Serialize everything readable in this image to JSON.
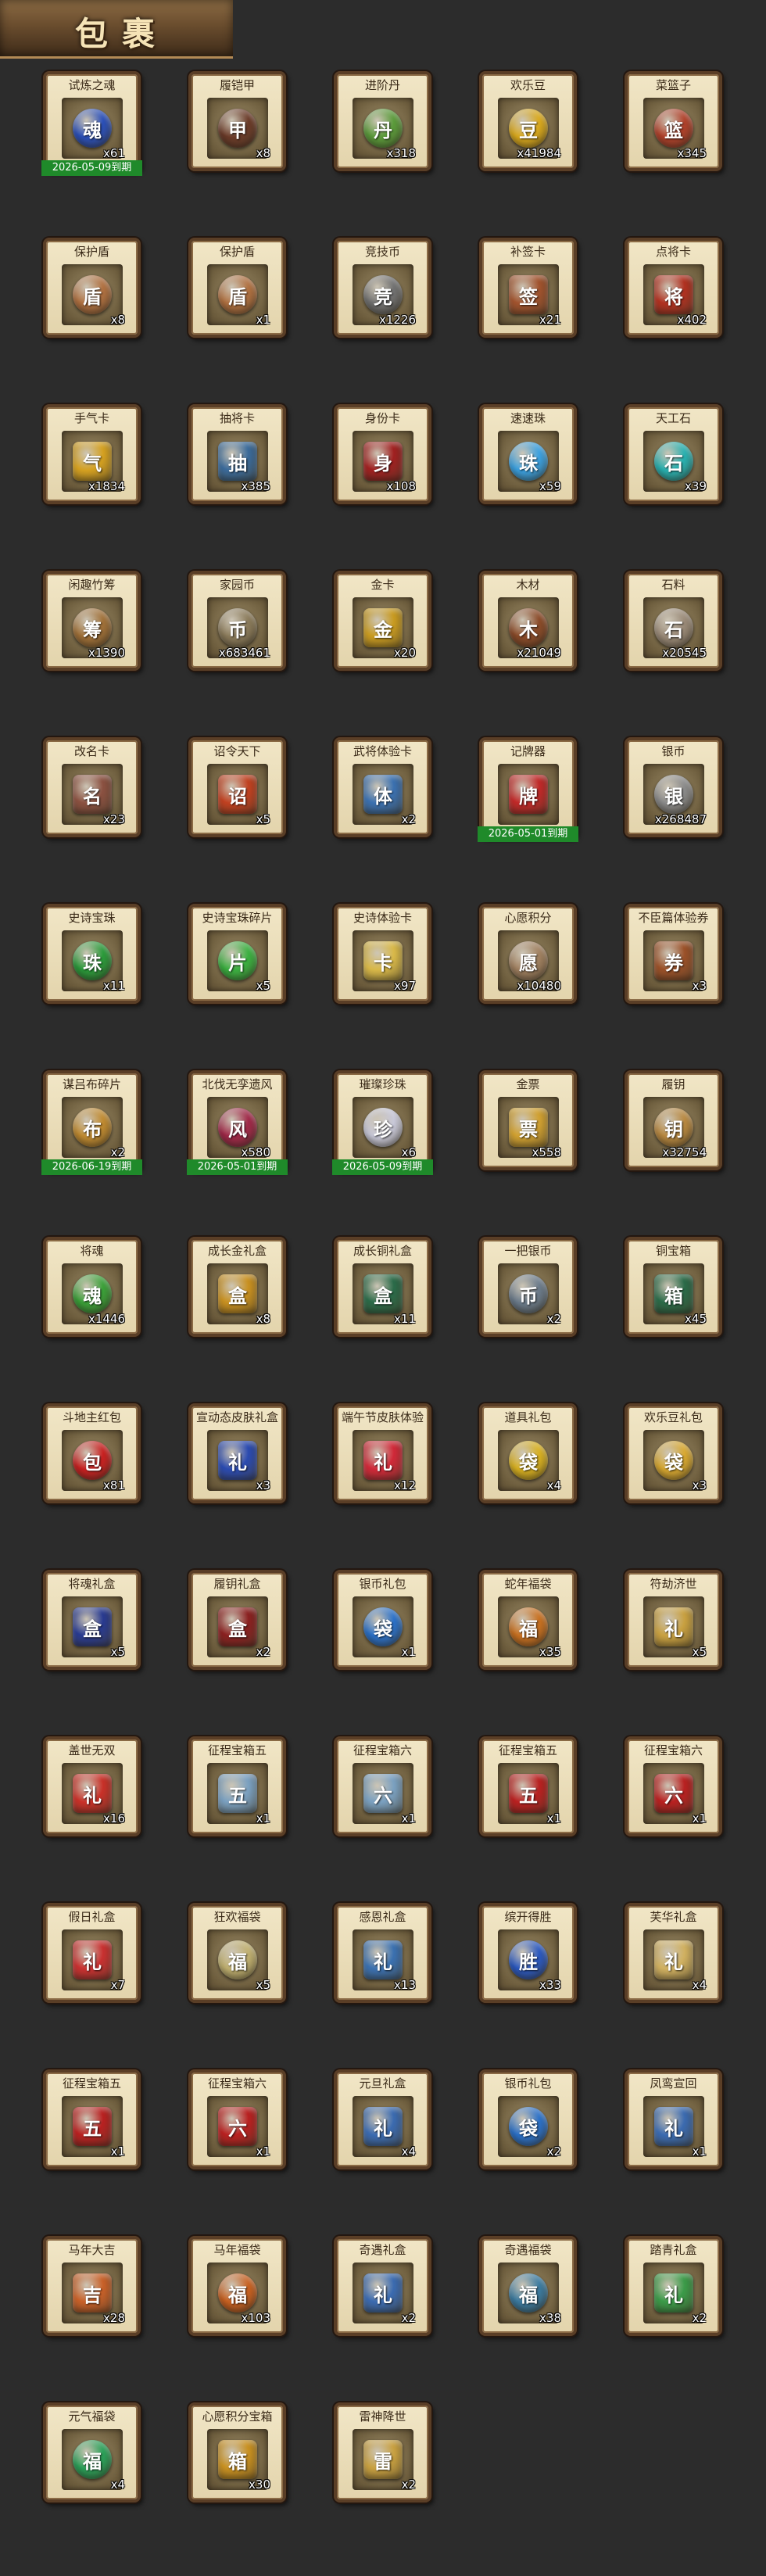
{
  "page": {
    "title": "包裹"
  },
  "items": [
    {
      "name": "试炼之魂",
      "qty": "x61",
      "expiry": "2026-05-09到期",
      "icon": "soul-orb-icon",
      "glyph": "魂",
      "color": "#2a4fb8"
    },
    {
      "name": "履铠甲",
      "qty": "x8",
      "expiry": "",
      "icon": "armor-icon",
      "glyph": "甲",
      "color": "#6a3a28"
    },
    {
      "name": "进阶丹",
      "qty": "x318",
      "expiry": "",
      "icon": "advance-pill-icon",
      "glyph": "丹",
      "color": "#5a9a3a"
    },
    {
      "name": "欢乐豆",
      "qty": "x41984",
      "expiry": "",
      "icon": "gold-beans-icon",
      "glyph": "豆",
      "color": "#d9a81c"
    },
    {
      "name": "菜篮子",
      "qty": "x345",
      "expiry": "",
      "icon": "basket-icon",
      "glyph": "篮",
      "color": "#b0402a"
    },
    {
      "name": "保护盾",
      "qty": "x8",
      "expiry": "",
      "icon": "shield-icon",
      "glyph": "盾",
      "color": "#b07040"
    },
    {
      "name": "保护盾",
      "qty": "x1",
      "expiry": "",
      "icon": "shield-icon",
      "glyph": "盾",
      "color": "#b07040"
    },
    {
      "name": "竞技币",
      "qty": "x1226",
      "expiry": "",
      "icon": "arena-coin-icon",
      "glyph": "竞",
      "color": "#707070"
    },
    {
      "name": "补签卡",
      "qty": "x21",
      "expiry": "",
      "icon": "resign-card-icon",
      "glyph": "签",
      "color": "#a0522d"
    },
    {
      "name": "点将卡",
      "qty": "x402",
      "expiry": "",
      "icon": "general-card-icon",
      "glyph": "将",
      "color": "#b03020"
    },
    {
      "name": "手气卡",
      "qty": "x1834",
      "expiry": "",
      "icon": "luck-card-icon",
      "glyph": "气",
      "color": "#d4a020"
    },
    {
      "name": "抽将卡",
      "qty": "x385",
      "expiry": "",
      "icon": "draw-card-icon",
      "glyph": "抽",
      "color": "#3a6a9a"
    },
    {
      "name": "身份卡",
      "qty": "x108",
      "expiry": "",
      "icon": "identity-card-icon",
      "glyph": "身",
      "color": "#a02020"
    },
    {
      "name": "速速珠",
      "qty": "x59",
      "expiry": "",
      "icon": "speed-pearl-icon",
      "glyph": "珠",
      "color": "#3aa0e0"
    },
    {
      "name": "天工石",
      "qty": "x39",
      "expiry": "",
      "icon": "gem-stone-icon",
      "glyph": "石",
      "color": "#28b0b0"
    },
    {
      "name": "闲趣竹筹",
      "qty": "x1390",
      "expiry": "",
      "icon": "bamboo-token-icon",
      "glyph": "筹",
      "color": "#a07038"
    },
    {
      "name": "家园币",
      "qty": "x683461",
      "expiry": "",
      "icon": "home-coin-icon",
      "glyph": "币",
      "color": "#8a7a5a"
    },
    {
      "name": "金卡",
      "qty": "x20",
      "expiry": "",
      "icon": "gold-card-icon",
      "glyph": "金",
      "color": "#c89a20"
    },
    {
      "name": "木材",
      "qty": "x21049",
      "expiry": "",
      "icon": "wood-icon",
      "glyph": "木",
      "color": "#8a4a28"
    },
    {
      "name": "石料",
      "qty": "x20545",
      "expiry": "",
      "icon": "stone-icon",
      "glyph": "石",
      "color": "#9a8a78"
    },
    {
      "name": "改名卡",
      "qty": "x23",
      "expiry": "",
      "icon": "rename-card-icon",
      "glyph": "名",
      "color": "#8a5040"
    },
    {
      "name": "诏令天下",
      "qty": "x5",
      "expiry": "",
      "icon": "decree-scroll-icon",
      "glyph": "诏",
      "color": "#c04020"
    },
    {
      "name": "武将体验卡",
      "qty": "x2",
      "expiry": "",
      "icon": "trial-card-icon",
      "glyph": "体",
      "color": "#3a70b0"
    },
    {
      "name": "记牌器",
      "qty": "",
      "expiry": "2026-05-01到期",
      "icon": "card-counter-icon",
      "glyph": "牌",
      "color": "#c02828"
    },
    {
      "name": "银币",
      "qty": "x268487",
      "expiry": "",
      "icon": "silver-coin-icon",
      "glyph": "银",
      "color": "#8a8a8a"
    },
    {
      "name": "史诗宝珠",
      "qty": "x11",
      "expiry": "",
      "icon": "epic-pearl-icon",
      "glyph": "珠",
      "color": "#2a9a3a"
    },
    {
      "name": "史诗宝珠碎片",
      "qty": "x5",
      "expiry": "",
      "icon": "pearl-fragment-icon",
      "glyph": "片",
      "color": "#3ab040"
    },
    {
      "name": "史诗体验卡",
      "qty": "x97",
      "expiry": "",
      "icon": "epic-trial-card-icon",
      "glyph": "卡",
      "color": "#d8b848"
    },
    {
      "name": "心愿积分",
      "qty": "x10480",
      "expiry": "",
      "icon": "wish-points-icon",
      "glyph": "愿",
      "color": "#a08060"
    },
    {
      "name": "不臣篇体验券",
      "qty": "x3",
      "expiry": "",
      "icon": "voucher-icon",
      "glyph": "券",
      "color": "#9a5028"
    },
    {
      "name": "谋吕布碎片",
      "qty": "x2",
      "expiry": "2026-06-19到期",
      "icon": "hero-fragment-icon",
      "glyph": "布",
      "color": "#c08a30"
    },
    {
      "name": "北伐无孪遗风",
      "qty": "x580",
      "expiry": "2026-05-01到期",
      "icon": "hero-portrait-icon",
      "glyph": "风",
      "color": "#a02848"
    },
    {
      "name": "璀璨珍珠",
      "qty": "x6",
      "expiry": "2026-05-09到期",
      "icon": "pearl-icon",
      "glyph": "珍",
      "color": "#c8c8d8"
    },
    {
      "name": "金票",
      "qty": "x558",
      "expiry": "",
      "icon": "gold-ticket-icon",
      "glyph": "票",
      "color": "#d0a030"
    },
    {
      "name": "履钥",
      "qty": "x32754",
      "expiry": "",
      "icon": "key-icon",
      "glyph": "钥",
      "color": "#b88840"
    },
    {
      "name": "将魂",
      "qty": "x1446",
      "expiry": "",
      "icon": "general-soul-icon",
      "glyph": "魂",
      "color": "#3aa038"
    },
    {
      "name": "成长金礼盒",
      "qty": "x8",
      "expiry": "",
      "icon": "gold-chest-icon",
      "glyph": "盒",
      "color": "#c89020"
    },
    {
      "name": "成长铜礼盒",
      "qty": "x11",
      "expiry": "",
      "icon": "copper-chest-icon",
      "glyph": "盒",
      "color": "#2a6a48"
    },
    {
      "name": "一把银币",
      "qty": "x2",
      "expiry": "",
      "icon": "silver-coins-icon",
      "glyph": "币",
      "color": "#6a7a8a"
    },
    {
      "name": "铜宝箱",
      "qty": "x45",
      "expiry": "",
      "icon": "copper-box-icon",
      "glyph": "箱",
      "color": "#2a6a48"
    },
    {
      "name": "斗地主红包",
      "qty": "x81",
      "expiry": "",
      "icon": "red-packet-icon",
      "glyph": "包",
      "color": "#c82020"
    },
    {
      "name": "宣动态皮肤礼盒",
      "qty": "x3",
      "expiry": "",
      "icon": "gift-box-icon",
      "glyph": "礼",
      "color": "#2a4ab0"
    },
    {
      "name": "端午节皮肤体验",
      "qty": "x12",
      "expiry": "",
      "icon": "gift-box-icon",
      "glyph": "礼",
      "color": "#d02838"
    },
    {
      "name": "道具礼包",
      "qty": "x4",
      "expiry": "",
      "icon": "item-bag-icon",
      "glyph": "袋",
      "color": "#d8b020"
    },
    {
      "name": "欢乐豆礼包",
      "qty": "x3",
      "expiry": "",
      "icon": "bean-bag-icon",
      "glyph": "袋",
      "color": "#d8a830"
    },
    {
      "name": "将魂礼盒",
      "qty": "x5",
      "expiry": "",
      "icon": "blue-box-icon",
      "glyph": "盒",
      "color": "#283a90"
    },
    {
      "name": "履钥礼盒",
      "qty": "x2",
      "expiry": "",
      "icon": "red-box-icon",
      "glyph": "盒",
      "color": "#8a2020"
    },
    {
      "name": "银币礼包",
      "qty": "x1",
      "expiry": "",
      "icon": "silver-bag-icon",
      "glyph": "袋",
      "color": "#2a70c8"
    },
    {
      "name": "蛇年福袋",
      "qty": "x35",
      "expiry": "",
      "icon": "lucky-bag-icon",
      "glyph": "福",
      "color": "#c87020"
    },
    {
      "name": "符劫济世",
      "qty": "x5",
      "expiry": "",
      "icon": "gift-box-icon",
      "glyph": "礼",
      "color": "#c8a040"
    },
    {
      "name": "盖世无双",
      "qty": "x16",
      "expiry": "",
      "icon": "gift-box-icon",
      "glyph": "礼",
      "color": "#c83028"
    },
    {
      "name": "征程宝箱五",
      "qty": "x1",
      "expiry": "",
      "icon": "silver-gift-icon",
      "glyph": "五",
      "color": "#7aa0c0"
    },
    {
      "name": "征程宝箱六",
      "qty": "x1",
      "expiry": "",
      "icon": "silver-gift-icon",
      "glyph": "六",
      "color": "#7aa0c0"
    },
    {
      "name": "征程宝箱五",
      "qty": "x1",
      "expiry": "",
      "icon": "red-chest-icon",
      "glyph": "五",
      "color": "#b82020"
    },
    {
      "name": "征程宝箱六",
      "qty": "x1",
      "expiry": "",
      "icon": "red-chest-icon",
      "glyph": "六",
      "color": "#b82020"
    },
    {
      "name": "假日礼盒",
      "qty": "x7",
      "expiry": "",
      "icon": "gift-box-icon",
      "glyph": "礼",
      "color": "#c83030"
    },
    {
      "name": "狂欢福袋",
      "qty": "x5",
      "expiry": "",
      "icon": "lucky-bag-icon",
      "glyph": "福",
      "color": "#c0b070"
    },
    {
      "name": "感恩礼盒",
      "qty": "x13",
      "expiry": "",
      "icon": "gift-box-icon",
      "glyph": "礼",
      "color": "#3a70b0"
    },
    {
      "name": "缤开得胜",
      "qty": "x33",
      "expiry": "",
      "icon": "blue-bag-icon",
      "glyph": "胜",
      "color": "#2a58c0"
    },
    {
      "name": "芙华礼盒",
      "qty": "x4",
      "expiry": "",
      "icon": "gift-box-icon",
      "glyph": "礼",
      "color": "#d0b060"
    },
    {
      "name": "征程宝箱五",
      "qty": "x1",
      "expiry": "",
      "icon": "red-chest-icon",
      "glyph": "五",
      "color": "#b82020"
    },
    {
      "name": "征程宝箱六",
      "qty": "x1",
      "expiry": "",
      "icon": "red-chest-icon",
      "glyph": "六",
      "color": "#b82020"
    },
    {
      "name": "元旦礼盒",
      "qty": "x4",
      "expiry": "",
      "icon": "gift-box-icon",
      "glyph": "礼",
      "color": "#3a6ab0"
    },
    {
      "name": "银币礼包",
      "qty": "x2",
      "expiry": "",
      "icon": "silver-bag-icon",
      "glyph": "袋",
      "color": "#2a70c8"
    },
    {
      "name": "凤鸾宣回",
      "qty": "x1",
      "expiry": "",
      "icon": "gift-box-icon",
      "glyph": "礼",
      "color": "#3a6ab0"
    },
    {
      "name": "马年大吉",
      "qty": "x28",
      "expiry": "",
      "icon": "gift-box-icon",
      "glyph": "吉",
      "color": "#c86028"
    },
    {
      "name": "马年福袋",
      "qty": "x103",
      "expiry": "",
      "icon": "lucky-bag-icon",
      "glyph": "福",
      "color": "#c86020"
    },
    {
      "name": "奇遇礼盒",
      "qty": "x2",
      "expiry": "",
      "icon": "gift-box-icon",
      "glyph": "礼",
      "color": "#3a6ab0"
    },
    {
      "name": "奇遇福袋",
      "qty": "x38",
      "expiry": "",
      "icon": "lucky-bag-icon",
      "glyph": "福",
      "color": "#3a7aa0"
    },
    {
      "name": "踏青礼盒",
      "qty": "x2",
      "expiry": "",
      "icon": "gift-box-icon",
      "glyph": "礼",
      "color": "#3a9a48"
    },
    {
      "name": "元气福袋",
      "qty": "x4",
      "expiry": "",
      "icon": "lucky-bag-icon",
      "glyph": "福",
      "color": "#2aa058"
    },
    {
      "name": "心愿积分宝箱",
      "qty": "x30",
      "expiry": "",
      "icon": "gold-chest-icon",
      "glyph": "箱",
      "color": "#c89020"
    },
    {
      "name": "雷神降世",
      "qty": "x2",
      "expiry": "",
      "icon": "gift-box-icon",
      "glyph": "雷",
      "color": "#c8a040"
    }
  ]
}
